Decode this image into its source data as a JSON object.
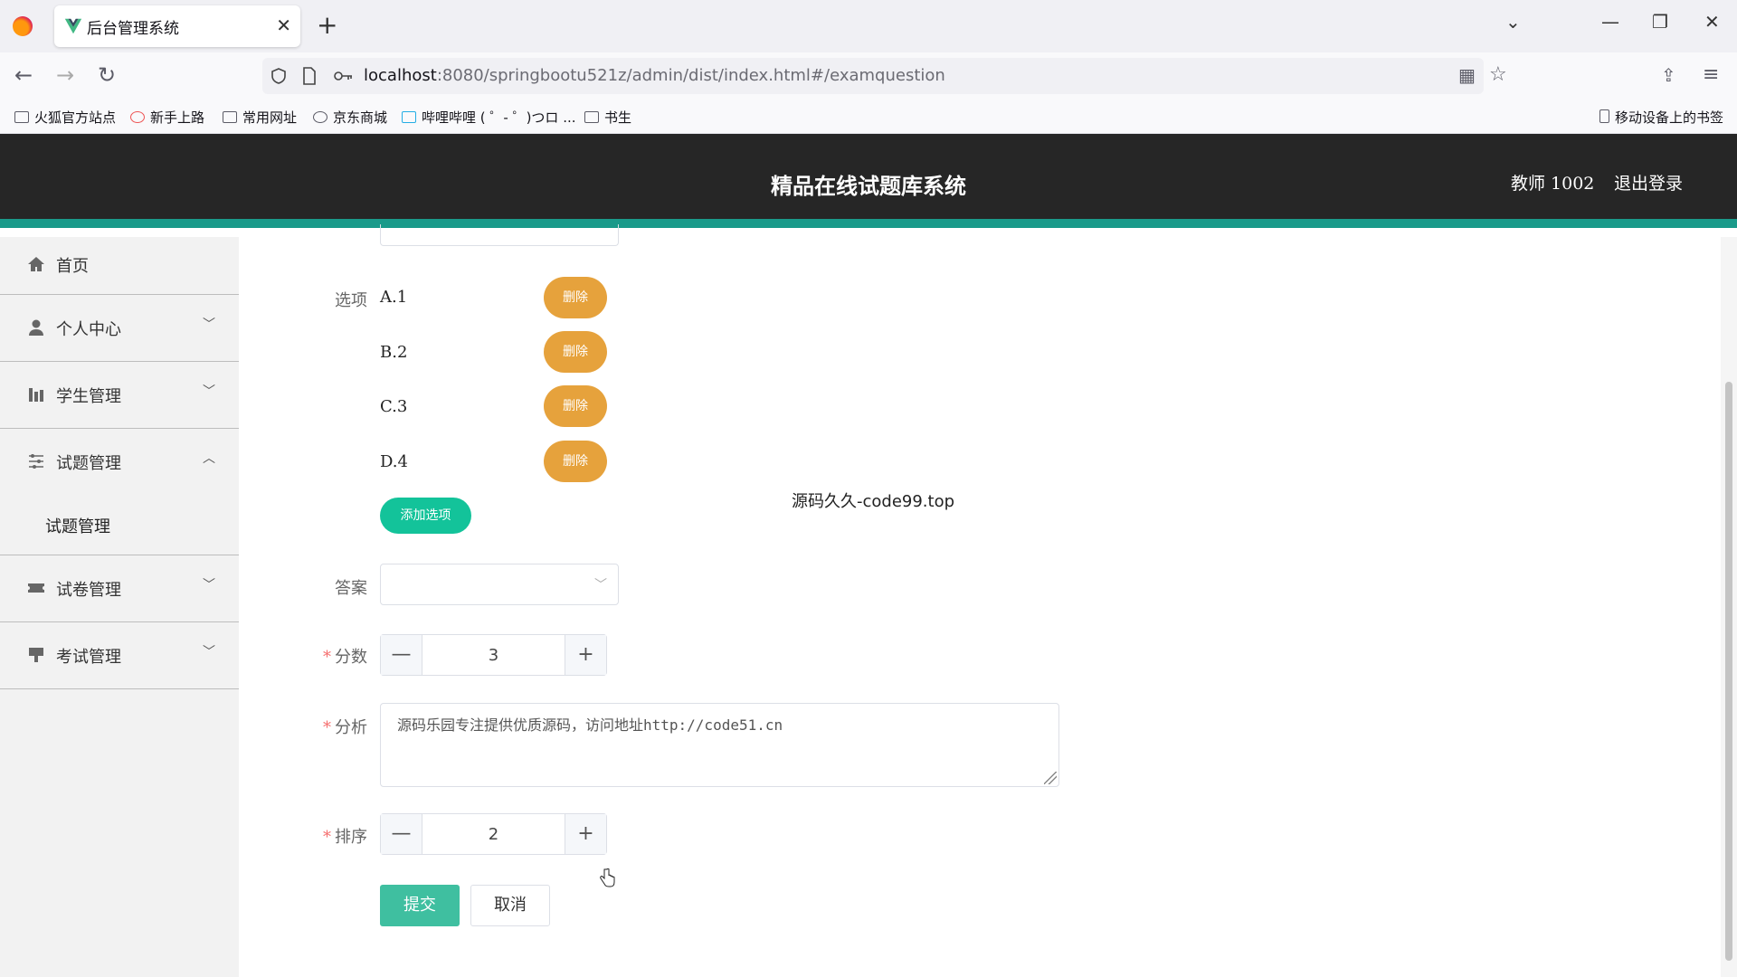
{
  "browser": {
    "tab_title": "后台管理系统",
    "url_host": "localhost",
    "url_rest": ":8080/springbootu521z/admin/dist/index.html#/examquestion",
    "bookmarks": [
      "火狐官方站点",
      "新手上路",
      "常用网址",
      "京东商城",
      "哔哩哔哩 ( ゜- ゜)つロ ...",
      "书生"
    ],
    "mobile_bookmarks": "移动设备上的书签"
  },
  "header": {
    "title": "精品在线试题库系统",
    "user": "教师 1002",
    "logout": "退出登录"
  },
  "sidebar": {
    "items": [
      {
        "label": "首页"
      },
      {
        "label": "个人中心"
      },
      {
        "label": "学生管理"
      },
      {
        "label": "试题管理"
      },
      {
        "label": "试卷管理"
      },
      {
        "label": "考试管理"
      }
    ],
    "sub_item": "试题管理"
  },
  "form": {
    "options_label": "选项",
    "options": [
      "A.1",
      "B.2",
      "C.3",
      "D.4"
    ],
    "delete_label": "删除",
    "add_option": "添加选项",
    "answer_label": "答案",
    "answer_value": "",
    "score_label": "分数",
    "score_value": "3",
    "analysis_label": "分析",
    "analysis_value": "源码乐园专注提供优质源码，访问地址http://code51.cn",
    "sort_label": "排序",
    "sort_value": "2",
    "submit": "提交",
    "cancel": "取消"
  },
  "overlay_text": "源码久久-code99.top",
  "colors": {
    "header_bg": "#262626",
    "accent": "#1a9a8a",
    "delete_btn": "#e6a23c",
    "add_btn": "#13c39a",
    "submit_btn": "#3fbfa0"
  }
}
